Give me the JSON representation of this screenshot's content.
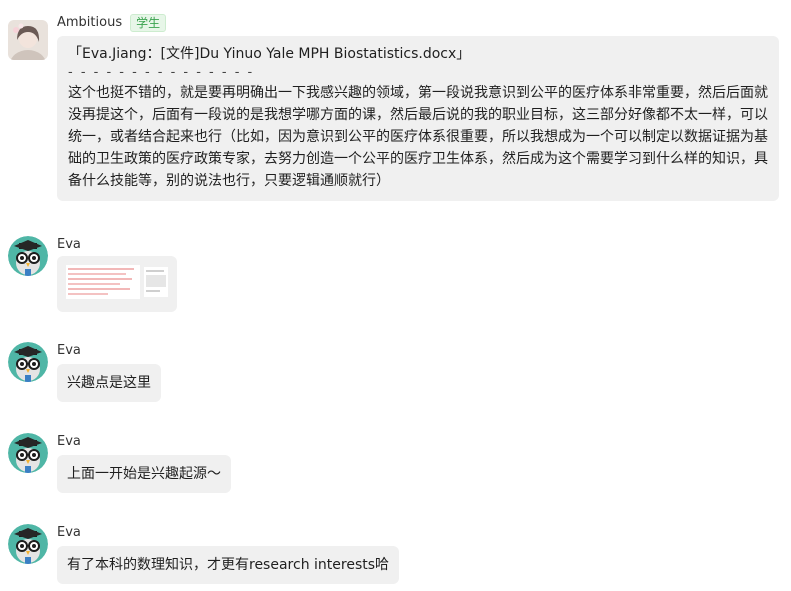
{
  "messages": [
    {
      "sender": "Ambitious",
      "role_tag": "学生",
      "quote_title": "「Eva.Jiang：[文件]Du Yinuo Yale MPH Biostatistics.docx」",
      "divider": "- - - - - - - - - - - - - - -",
      "text": "这个也挺不错的，就是要再明确出一下我感兴趣的领域，第一段说我意识到公平的医疗体系非常重要，然后后面就没再提这个，后面有一段说的是我想学哪方面的课，然后最后说的我的职业目标，这三部分好像都不太一样，可以统一，或者结合起来也行（比如，因为意识到公平的医疗体系很重要，所以我想成为一个可以制定以数据证据为基础的卫生政策的医疗政策专家，去努力创造一个公平的医疗卫生体系，然后成为这个需要学习到什么样的知识，具备什么技能等，别的说法也行，只要逻辑通顺就行）"
    },
    {
      "sender": "Eva",
      "type": "image"
    },
    {
      "sender": "Eva",
      "text": "兴趣点是这里"
    },
    {
      "sender": "Eva",
      "text": "上面一开始是兴趣起源～"
    },
    {
      "sender": "Eva",
      "text": "有了本科的数理知识，才更有research interests哈"
    }
  ],
  "colors": {
    "bubble": "#f0f0f0",
    "tag_text": "#3aa34f",
    "tag_bg": "#e7f6e8",
    "eva_avatar_bg": "#4fb6a6"
  },
  "icons": [
    "student-avatar",
    "graduate-owl-avatar"
  ]
}
